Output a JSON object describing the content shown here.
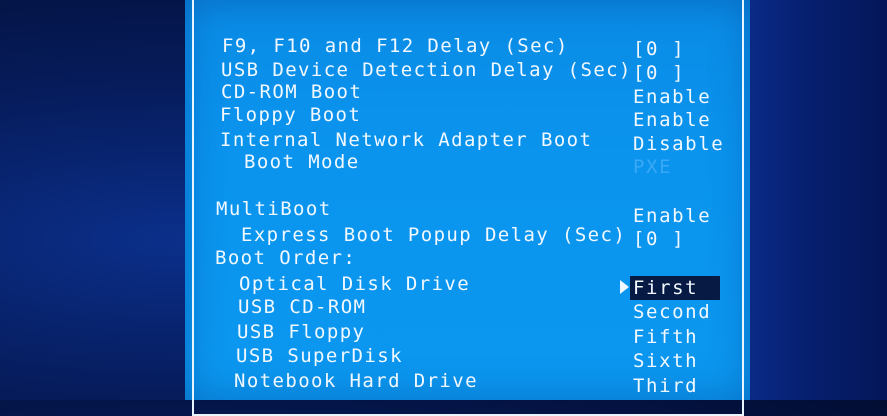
{
  "settings": [
    {
      "label": "F9, F10 and F12 Delay (Sec)",
      "value": "[0 ]"
    },
    {
      "label": "USB Device Detection Delay (Sec)",
      "value": "[0 ]"
    },
    {
      "label": "CD-ROM Boot",
      "value": "Enable"
    },
    {
      "label": "Floppy Boot",
      "value": "Enable"
    },
    {
      "label": "Internal Network Adapter Boot",
      "value": "Disable"
    },
    {
      "label": "Boot Mode",
      "value": "PXE"
    },
    {
      "label": "MultiBoot",
      "value": "Enable"
    },
    {
      "label": "Express Boot Popup Delay (Sec)",
      "value": "[0 ]"
    }
  ],
  "boot_order": {
    "header": "Boot Order:",
    "items": [
      {
        "label": "Optical Disk Drive",
        "value": "First"
      },
      {
        "label": "USB CD-ROM",
        "value": "Second"
      },
      {
        "label": "USB Floppy",
        "value": "Fifth"
      },
      {
        "label": "USB SuperDisk",
        "value": "Sixth"
      },
      {
        "label": "Notebook Hard Drive",
        "value": "Third"
      }
    ]
  },
  "colors": {
    "screen": "#0a94ee",
    "text": "#f1f8ff",
    "disabled": "#3aa9f5",
    "selection": "#061a44"
  }
}
